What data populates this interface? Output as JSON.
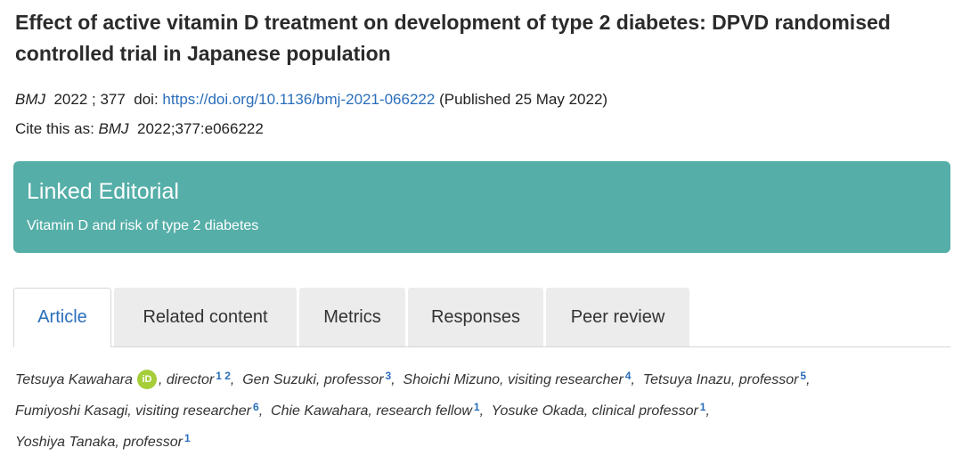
{
  "article": {
    "title": "Effect of active vitamin D treatment on development of type 2 diabetes: DPVD randomised controlled trial in Japanese population",
    "journal": "BMJ",
    "year_vol": "2022 ; 377",
    "doi_label": "doi:",
    "doi_url": "https://doi.org/10.1136/bmj-2021-066222",
    "published": "(Published 25 May 2022)",
    "cite_label": "Cite this as:",
    "cite_value": "2022;377:e066222"
  },
  "editorial": {
    "heading": "Linked Editorial",
    "link": "Vitamin D and risk of type 2 diabetes",
    "color": "#55aea8"
  },
  "tabs": [
    {
      "label": "Article",
      "active": true
    },
    {
      "label": "Related content",
      "active": false
    },
    {
      "label": "Metrics",
      "active": false
    },
    {
      "label": "Responses",
      "active": false
    },
    {
      "label": "Peer review",
      "active": false
    }
  ],
  "authors": [
    {
      "name": "Tetsuya Kawahara",
      "orcid": "iD",
      "role": ", director",
      "affs": "1 2"
    },
    {
      "name": "Gen Suzuki, professor",
      "affs": "3"
    },
    {
      "name": "Shoichi Mizuno, visiting researcher",
      "affs": "4"
    },
    {
      "name": "Tetsuya Inazu, professor",
      "affs": "5"
    },
    {
      "name": "Fumiyoshi Kasagi, visiting researcher",
      "affs": "6"
    },
    {
      "name": "Chie Kawahara, research fellow",
      "affs": "1"
    },
    {
      "name": "Yosuke Okada, clinical professor",
      "affs": "1"
    },
    {
      "name": "Yoshiya Tanaka, professor",
      "affs": "1"
    }
  ],
  "colors": {
    "link": "#2a6ebb",
    "orcid": "#a6ce39",
    "tab_inactive": "#ececec"
  }
}
